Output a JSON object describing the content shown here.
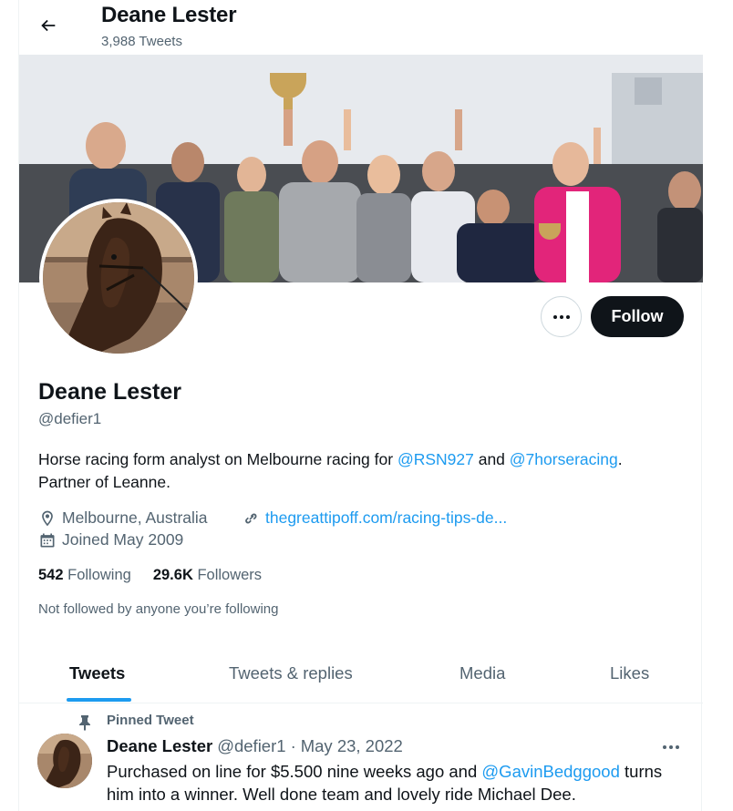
{
  "header": {
    "name": "Deane Lester",
    "tweet_count": "3,988 Tweets"
  },
  "profile": {
    "name": "Deane Lester",
    "handle": "@defier1",
    "bio_pre": "Horse racing form analyst on Melbourne racing for ",
    "bio_link1": "@RSN927",
    "bio_mid": " and ",
    "bio_link2": "@7horseracing",
    "bio_post": ".",
    "bio_line2": "Partner of Leanne.",
    "location": "Melbourne, Australia",
    "website": "thegreattipoff.com/racing-tips-de...",
    "joined": "Joined May 2009",
    "following_count": "542",
    "following_label": "Following",
    "followers_count": "29.6K",
    "followers_label": "Followers",
    "not_followed": "Not followed by anyone you’re following"
  },
  "actions": {
    "follow_label": "Follow"
  },
  "tabs": [
    {
      "label": "Tweets",
      "active": true
    },
    {
      "label": "Tweets & replies",
      "active": false
    },
    {
      "label": "Media",
      "active": false
    },
    {
      "label": "Likes",
      "active": false
    }
  ],
  "tweet": {
    "pinned_label": "Pinned Tweet",
    "author": "Deane Lester",
    "handle": "@defier1",
    "separator": "·",
    "date": "May 23, 2022",
    "text_pre": "Purchased on line for $5.500 nine weeks ago and ",
    "text_link": "@GavinBedggood",
    "text_post": " turns him into a winner. Well done team and lovely ride Michael Dee."
  },
  "colors": {
    "accent": "#1d9bf0",
    "text": "#0f1419",
    "muted": "#536471",
    "follow_bg": "#0f1419"
  }
}
